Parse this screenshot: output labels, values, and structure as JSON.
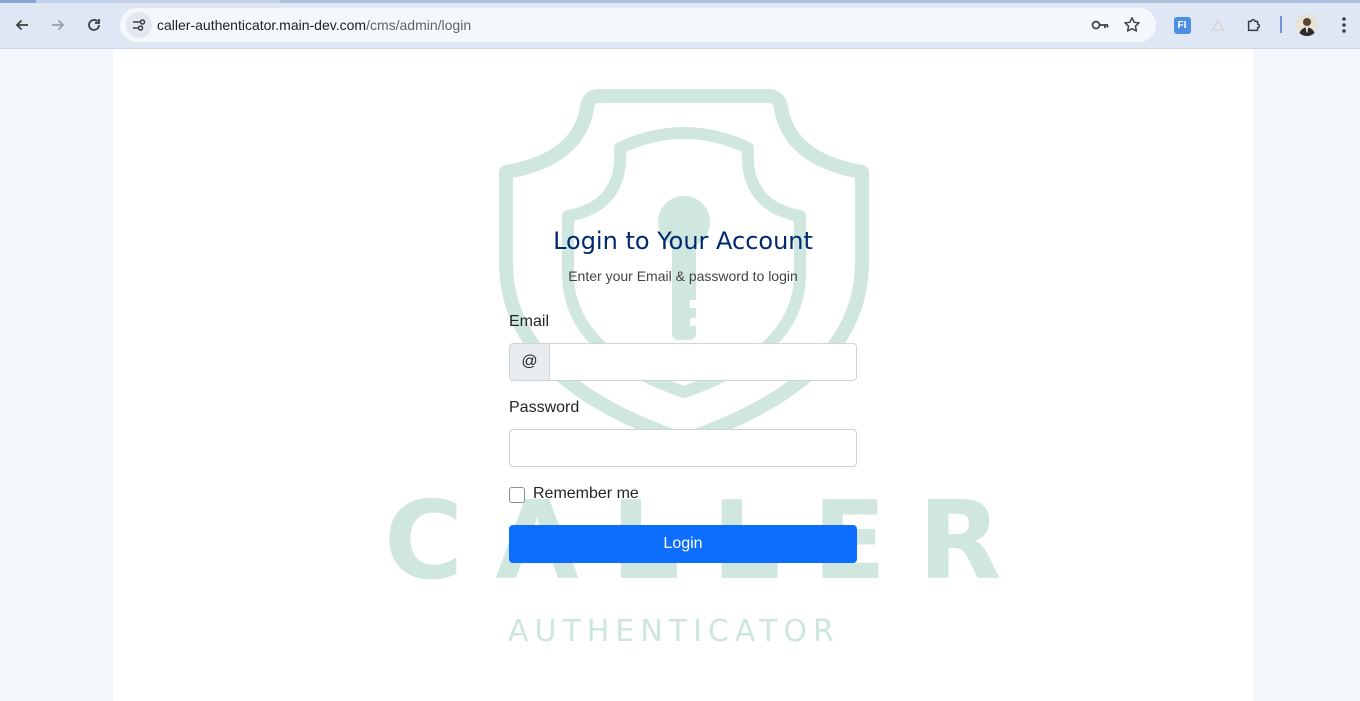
{
  "browser": {
    "url_host": "caller-authenticator.main-dev.com",
    "url_path": "/cms/admin/login",
    "extension_badge": "FI"
  },
  "watermark": {
    "brand": "CALLER",
    "tagline": "AUTHENTICATOR"
  },
  "login": {
    "title": "Login to Your Account",
    "subtitle": "Enter your Email & password to login",
    "email_label": "Email",
    "email_addon": "@",
    "email_value": "",
    "password_label": "Password",
    "password_value": "",
    "remember_label": "Remember me",
    "remember_checked": false,
    "submit_label": "Login"
  },
  "colors": {
    "title": "#012970",
    "primary_button": "#0d6efd",
    "watermark": "#cfe7df",
    "page_bg": "#f3f6fb"
  },
  "icons": [
    "back-icon",
    "forward-icon",
    "reload-icon",
    "site-info-icon",
    "key-icon",
    "star-icon",
    "extension-icon",
    "puzzle-icon",
    "avatar",
    "menu-icon",
    "shield-logo"
  ]
}
